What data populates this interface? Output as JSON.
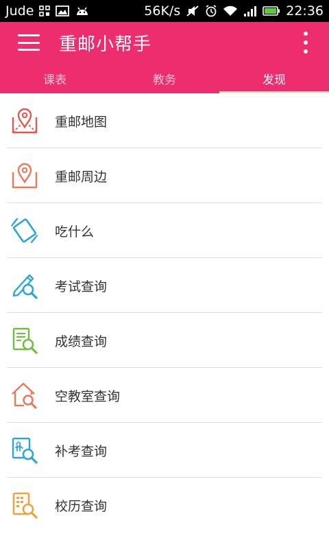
{
  "status_bar": {
    "carrier": "Jude",
    "net_speed": "56K/s",
    "time": "22:36"
  },
  "app_bar": {
    "title": "重邮小帮手"
  },
  "tabs": [
    {
      "label": "课表",
      "active": false
    },
    {
      "label": "教务",
      "active": false
    },
    {
      "label": "发现",
      "active": true
    }
  ],
  "list": {
    "items": [
      {
        "label": "重邮地图",
        "icon": "map-pin-icon",
        "color": "#e05a4f"
      },
      {
        "label": "重邮周边",
        "icon": "location-frame-icon",
        "color": "#e8795a"
      },
      {
        "label": "吃什么",
        "icon": "rotate-card-icon",
        "color": "#2aa5d6"
      },
      {
        "label": "考试查询",
        "icon": "pen-search-icon",
        "color": "#2aa5d6"
      },
      {
        "label": "成绩查询",
        "icon": "doc-search-icon",
        "color": "#6cbf3f"
      },
      {
        "label": "空教室查询",
        "icon": "home-search-icon",
        "color": "#e8795a"
      },
      {
        "label": "补考查询",
        "icon": "makeup-search-icon",
        "color": "#2aa5d6"
      },
      {
        "label": "校历查询",
        "icon": "calendar-search-icon",
        "color": "#f0a23a"
      }
    ]
  },
  "colors": {
    "accent": "#ee2d6e",
    "tab_indicator": "#fde8c9"
  }
}
